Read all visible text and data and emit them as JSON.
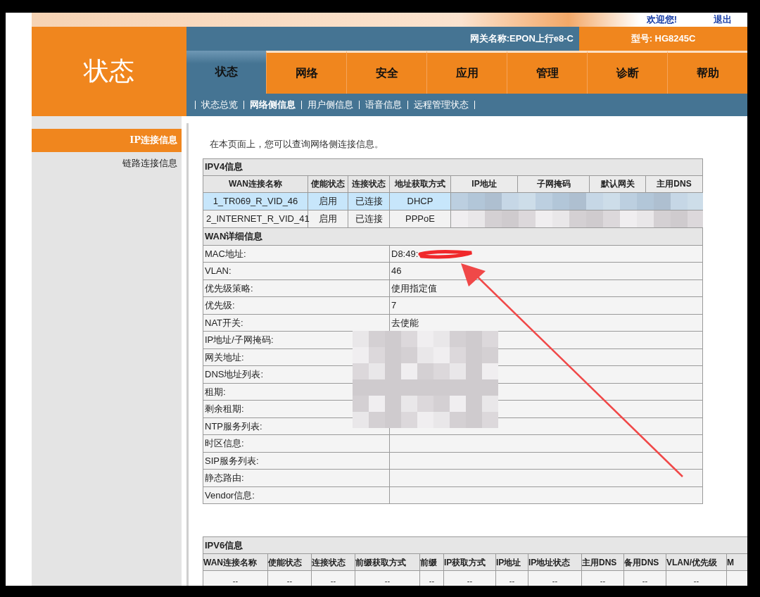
{
  "header": {
    "welcome": "欢迎您!",
    "logout": "退出",
    "gateway_name": "网关名称:EPON上行e8-C",
    "model": "型号: HG8245C",
    "page_title": "状态"
  },
  "tabs": [
    {
      "label": "状态",
      "selected": true
    },
    {
      "label": "网络",
      "selected": false
    },
    {
      "label": "安全",
      "selected": false
    },
    {
      "label": "应用",
      "selected": false
    },
    {
      "label": "管理",
      "selected": false
    },
    {
      "label": "诊断",
      "selected": false
    },
    {
      "label": "帮助",
      "selected": false
    }
  ],
  "subnav": [
    {
      "label": "状态总览",
      "selected": false
    },
    {
      "label": "网络侧信息",
      "selected": true
    },
    {
      "label": "用户侧信息",
      "selected": false
    },
    {
      "label": "语音信息",
      "selected": false
    },
    {
      "label": "远程管理状态",
      "selected": false
    }
  ],
  "sidebar": [
    {
      "label": "IP连接信息",
      "selected": true
    },
    {
      "label": "链路连接信息",
      "selected": false
    }
  ],
  "intro": "在本页面上，您可以查询网络侧连接信息。",
  "ipv4": {
    "title": "IPV4信息",
    "columns": [
      "WAN连接名称",
      "使能状态",
      "连接状态",
      "地址获取方式",
      "IP地址",
      "子网掩码",
      "默认网关",
      "主用DNS"
    ],
    "rows": [
      {
        "cells": [
          "1_TR069_R_VID_46",
          "启用",
          "已连接",
          "DHCP"
        ],
        "selected": true
      },
      {
        "cells": [
          "2_INTERNET_R_VID_41",
          "启用",
          "已连接",
          "PPPoE"
        ],
        "selected": false
      }
    ]
  },
  "wan_detail": {
    "title": "WAN详细信息",
    "rows": [
      {
        "label": "MAC地址:",
        "value": "D8:49:"
      },
      {
        "label": "VLAN:",
        "value": "46"
      },
      {
        "label": "优先级策略:",
        "value": "使用指定值"
      },
      {
        "label": "优先级:",
        "value": "7"
      },
      {
        "label": "NAT开关:",
        "value": "去使能"
      },
      {
        "label": "IP地址/子网掩码:"
      },
      {
        "label": "网关地址:"
      },
      {
        "label": "DNS地址列表:"
      },
      {
        "label": "租期:"
      },
      {
        "label": "剩余租期:"
      },
      {
        "label": "NTP服务列表:"
      },
      {
        "label": "时区信息:"
      },
      {
        "label": "SIP服务列表:"
      },
      {
        "label": "静态路由:"
      },
      {
        "label": "Vendor信息:"
      }
    ]
  },
  "ipv6": {
    "title": "IPV6信息",
    "columns": [
      "WAN连接名称",
      "使能状态",
      "连接状态",
      "前缀获取方式",
      "前缀",
      "IP获取方式",
      "IP地址",
      "IP地址状态",
      "主用DNS",
      "备用DNS",
      "VLAN/优先级",
      "M"
    ],
    "rows": [
      [
        "--",
        "--",
        "--",
        "--",
        "--",
        "--",
        "--",
        "--",
        "--",
        "--",
        "--"
      ]
    ]
  }
}
